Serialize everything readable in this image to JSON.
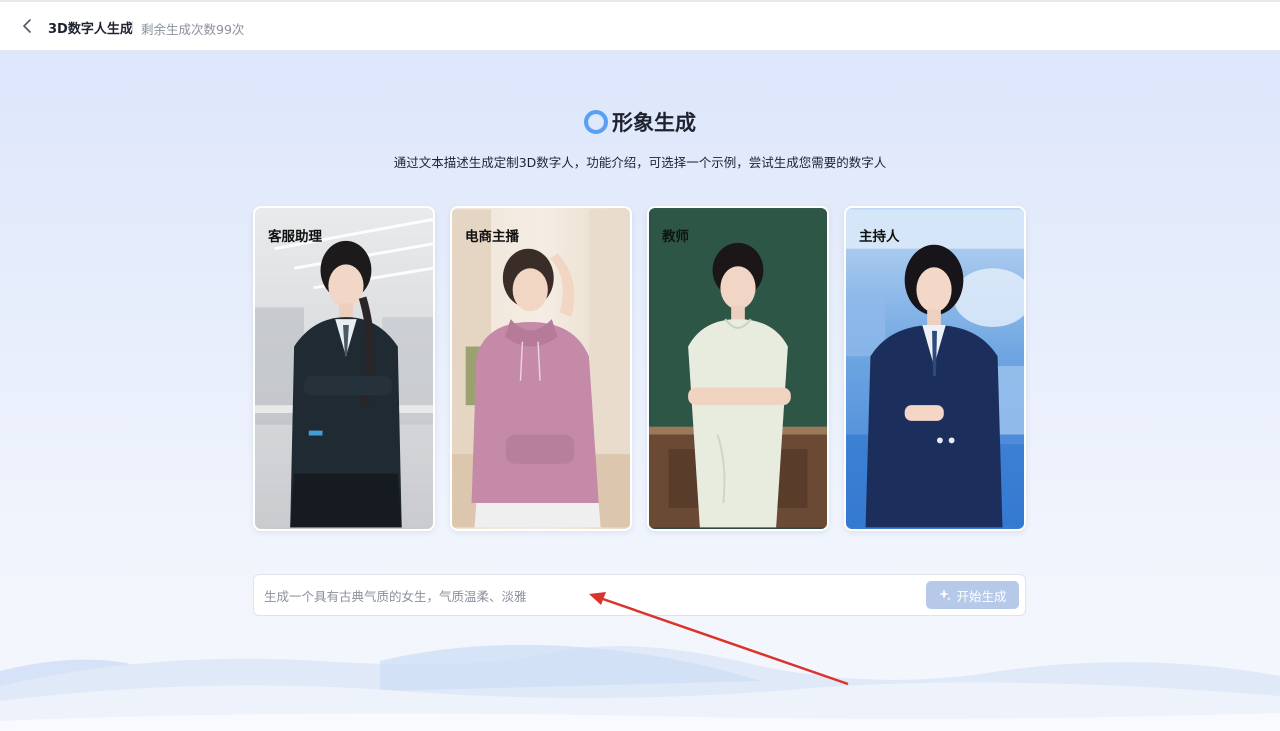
{
  "header": {
    "back_icon": "chevron-left-icon",
    "title": "3D数字人生成",
    "remaining": "剩余生成次数99次"
  },
  "main": {
    "heading": "形象生成",
    "heading_icon": "ring-logo-icon",
    "description": "通过文本描述生成定制3D数字人，功能介绍，可选择一个示例，尝试生成您需要的数字人",
    "cards": [
      {
        "label": "客服助理"
      },
      {
        "label": "电商主播"
      },
      {
        "label": "教师"
      },
      {
        "label": "主持人"
      }
    ],
    "prompt": {
      "placeholder": "生成一个具有古典气质的女生，气质温柔、淡雅",
      "button_label": "开始生成",
      "button_icon": "sparkle-icon"
    }
  },
  "colors": {
    "accent_ring": "#5aa0f2",
    "button_bg": "#b7c9e8",
    "annotation_arrow": "#d9342b"
  }
}
